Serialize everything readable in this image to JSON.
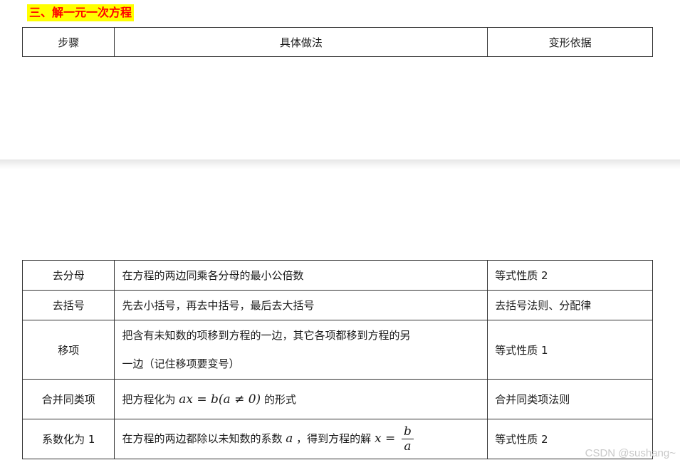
{
  "heading": "三、解一元一次方程",
  "table_header": {
    "col1": "步骤",
    "col2": "具体做法",
    "col3": "变形依据"
  },
  "rows": [
    {
      "step": "去分母",
      "method": "在方程的两边同乘各分母的最小公倍数",
      "basis": "等式性质 2"
    },
    {
      "step": "去括号",
      "method": "先去小括号，再去中括号，最后去大括号",
      "basis": "去括号法则、分配律"
    },
    {
      "step": "移项",
      "method_line1": "把含有未知数的项移到方程的一边，其它各项都移到方程的另",
      "method_line2": "一边（记住移项要变号）",
      "basis": "等式性质 1"
    },
    {
      "step": "合并同类项",
      "method_before": "把方程化为",
      "method_math": "ax = b(a ≠ 0)",
      "method_after": "的形式",
      "basis": "合并同类项法则"
    },
    {
      "step": "系数化为 1",
      "method_before": "在方程的两边都除以未知数的系数",
      "method_math": "a",
      "method_mid": "，得到方程的解",
      "method_math2": "x =",
      "frac_num": "b",
      "frac_den": "a",
      "basis": "等式性质 2"
    }
  ],
  "watermark": "CSDN @sushang~"
}
